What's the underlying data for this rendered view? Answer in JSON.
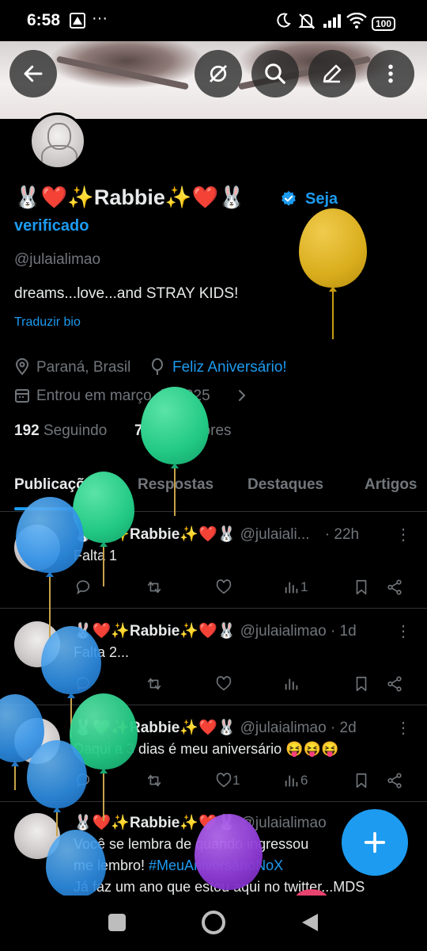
{
  "status_bar": {
    "time": "6:58",
    "battery": "100"
  },
  "profile": {
    "name": "🐰❤️✨Rabbie✨❤️🐰",
    "verify_cta_line1": "Seja",
    "verify_cta_line2": "verificado",
    "handle": "@julaialimao",
    "bio": "dreams...love...and STRAY KIDS!",
    "translate": "Traduzir bio",
    "location": "Paraná, Brasil",
    "birthday": "Feliz Aniversário!",
    "joined": "Entrou em março de 2025",
    "following_count": "192",
    "following_label": "Seguindo",
    "followers_count": "78",
    "followers_label": "Seguidores"
  },
  "tabs": [
    {
      "label": "Publicações",
      "active": true
    },
    {
      "label": "Respostas",
      "active": false
    },
    {
      "label": "Destaques",
      "active": false
    },
    {
      "label": "Artigos",
      "active": false
    }
  ],
  "posts": [
    {
      "name": "🐰💚✨Rabbie✨❤️🐰",
      "handle": "@julaiali...",
      "time": "· 22h",
      "text": "Falta 1",
      "likes": "",
      "views": "1"
    },
    {
      "name": "🐰❤️✨Rabbie✨❤️🐰",
      "handle": "@julaialimao",
      "time": "· 1d",
      "text": "Falta 2...",
      "likes": "",
      "views": ""
    },
    {
      "name": "🐰💚✨Rabbie✨❤️🐰",
      "handle": "@julaialimao",
      "time": "· 2d",
      "text": "Daqui a 3 dias é meu aniversário 😝😝😝",
      "likes": "1",
      "views": "6"
    },
    {
      "name": "🐰❤️✨Rabbie✨❤️🐰",
      "handle": "@julaialimao",
      "time": "",
      "text_line1": "Você se lembra de quando ingressou",
      "text_line2_prefix": "me lembro! ",
      "text_line2_tag": "#MeuAniversárioNoX",
      "text_line3": "Já faz um ano que estou aqui no twitter...MDS"
    }
  ],
  "icons": {
    "back": "arrow-left-icon",
    "grok": "grok-icon",
    "search": "search-icon",
    "edit": "edit-icon",
    "more": "more-vertical-icon",
    "verified": "verified-badge-icon",
    "location": "location-pin-icon",
    "birthday": "balloon-icon",
    "calendar": "calendar-icon",
    "reply": "reply-icon",
    "repost": "repost-icon",
    "like": "heart-icon",
    "views": "views-icon",
    "bookmark": "bookmark-icon",
    "share": "share-icon",
    "compose": "plus-icon"
  },
  "colors": {
    "accent": "#1d9bf0",
    "background": "#000000",
    "secondary_text": "#71767b",
    "balloon_gold": "#d9ad1c",
    "balloon_green": "#22c984",
    "balloon_blue": "#2e8fe6",
    "balloon_purple": "#8f3bd6"
  }
}
